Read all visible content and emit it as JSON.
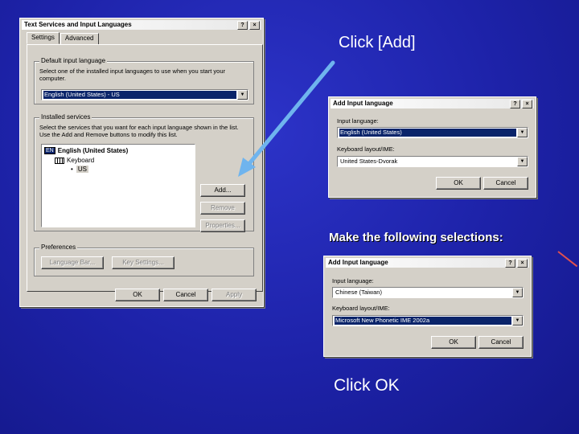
{
  "captions": {
    "click_add": "Click [Add]",
    "make_selections": "Make the following selections:",
    "click_ok": "Click OK"
  },
  "main_dialog": {
    "title": "Text Services and Input Languages",
    "help_btn": "?",
    "close_btn": "×",
    "tabs": [
      "Settings",
      "Advanced"
    ],
    "default_group": {
      "legend": "Default input language",
      "description": "Select one of the installed input languages to use when you start your computer.",
      "selected": "English (United States) - US"
    },
    "installed_group": {
      "legend": "Installed services",
      "description": "Select the services that you want for each input language shown in the list. Use the Add and Remove buttons to modify this list.",
      "tree_badge": "EN",
      "tree_language": "English (United States)",
      "tree_keyboard": "Keyboard",
      "tree_layout": "US"
    },
    "side_buttons": {
      "add": "Add...",
      "remove": "Remove",
      "properties": "Properties..."
    },
    "preferences_group": {
      "legend": "Preferences",
      "language_bar": "Language Bar...",
      "key_settings": "Key Settings..."
    },
    "footer": {
      "ok": "OK",
      "cancel": "Cancel",
      "apply": "Apply"
    }
  },
  "add_dialog_1": {
    "title": "Add Input language",
    "help_btn": "?",
    "close_btn": "×",
    "input_label": "Input language:",
    "input_value": "English (United States)",
    "keyboard_label": "Keyboard layout/IME:",
    "keyboard_value": "United States-Dvorak",
    "ok": "OK",
    "cancel": "Cancel"
  },
  "add_dialog_2": {
    "title": "Add Input language",
    "help_btn": "?",
    "close_btn": "×",
    "input_label": "Input language:",
    "input_value": "Chinese (Taiwan)",
    "keyboard_label": "Keyboard layout/IME:",
    "keyboard_value": "Microsoft New Phonetic IME 2002a",
    "ok": "OK",
    "cancel": "Cancel"
  },
  "colors": {
    "background": "#1d22a8",
    "arrow": "#6fb4ee",
    "selection": "#0a246a"
  }
}
